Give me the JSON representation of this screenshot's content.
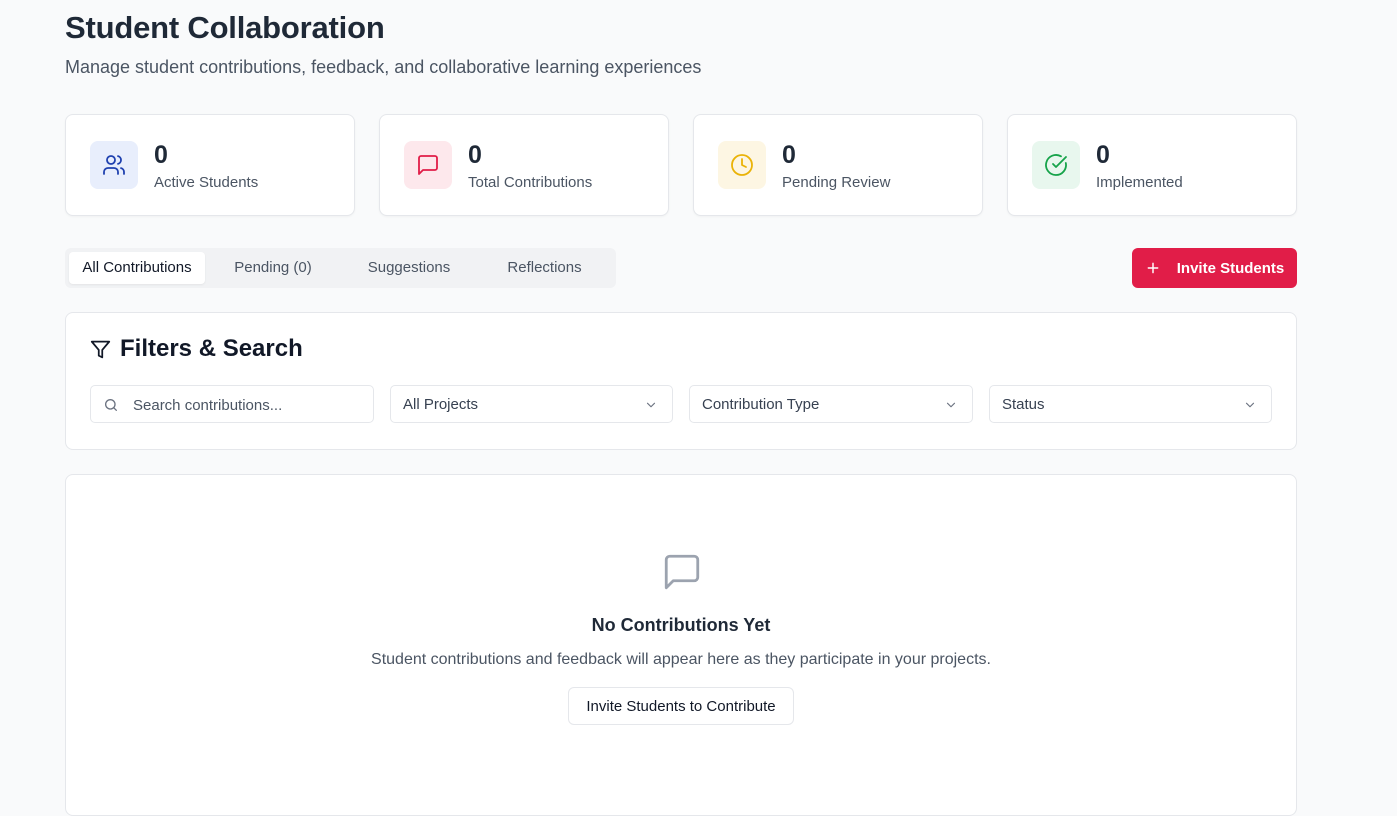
{
  "header": {
    "title": "Student Collaboration",
    "subtitle": "Manage student contributions, feedback, and collaborative learning experiences"
  },
  "stats": [
    {
      "value": "0",
      "label": "Active Students",
      "icon": "users-icon",
      "bg": "#e8eefc",
      "color": "#1e40af"
    },
    {
      "value": "0",
      "label": "Total Contributions",
      "icon": "message-square-icon",
      "bg": "#fde8ec",
      "color": "#e11d48"
    },
    {
      "value": "0",
      "label": "Pending Review",
      "icon": "clock-icon",
      "bg": "#fdf6e3",
      "color": "#eab308"
    },
    {
      "value": "0",
      "label": "Implemented",
      "icon": "check-circle-icon",
      "bg": "#e8f7ee",
      "color": "#16a34a"
    }
  ],
  "tabs": [
    {
      "label": "All Contributions",
      "active": true
    },
    {
      "label": "Pending (0)",
      "active": false
    },
    {
      "label": "Suggestions",
      "active": false
    },
    {
      "label": "Reflections",
      "active": false
    }
  ],
  "actions": {
    "invite_label": "Invite Students",
    "accent": "#e11d48"
  },
  "filters": {
    "title": "Filters & Search",
    "search_placeholder": "Search contributions...",
    "project_select": "All Projects",
    "type_select": "Contribution Type",
    "status_select": "Status"
  },
  "empty_state": {
    "title": "No Contributions Yet",
    "description": "Student contributions and feedback will appear here as they participate in your projects.",
    "button_label": "Invite Students to Contribute"
  }
}
